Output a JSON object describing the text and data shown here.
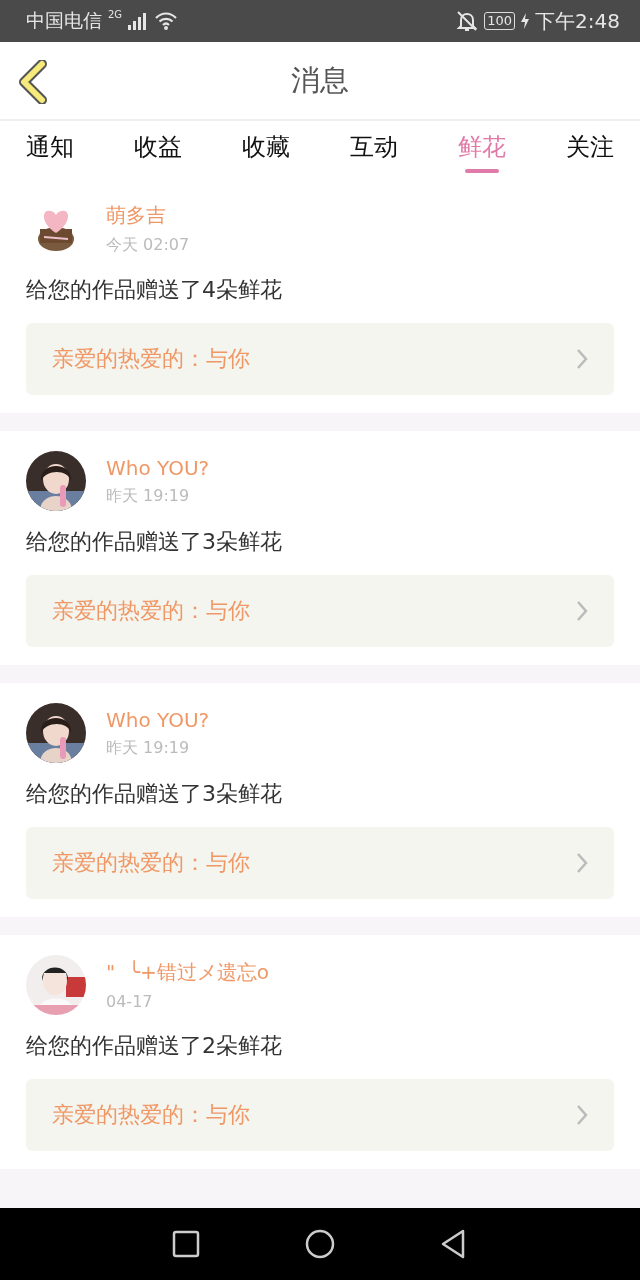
{
  "status_bar": {
    "carrier": "中国电信",
    "network": "2G",
    "battery": "100",
    "time": "下午2:48"
  },
  "header": {
    "title": "消息"
  },
  "tabs": [
    {
      "label": "通知",
      "selected": false
    },
    {
      "label": "收益",
      "selected": false
    },
    {
      "label": "收藏",
      "selected": false
    },
    {
      "label": "互动",
      "selected": false
    },
    {
      "label": "鲜花",
      "selected": true
    },
    {
      "label": "关注",
      "selected": false
    }
  ],
  "messages": [
    {
      "name": "萌多吉",
      "time": "今天 02:07",
      "text": "给您的作品赠送了4朵鲜花",
      "work": "亲爱的热爱的：与你"
    },
    {
      "name": "Who YOU?",
      "time": "昨天 19:19",
      "text": "给您的作品赠送了3朵鲜花",
      "work": "亲爱的热爱的：与你"
    },
    {
      "name": "Who YOU?",
      "time": "昨天 19:19",
      "text": "给您的作品赠送了3朵鲜花",
      "work": "亲爱的热爱的：与你"
    },
    {
      "name": "\"  ╰+错过メ遗忘o",
      "time": "04-17",
      "text": "给您的作品赠送了2朵鲜花",
      "work": "亲爱的热爱的：与你"
    }
  ]
}
